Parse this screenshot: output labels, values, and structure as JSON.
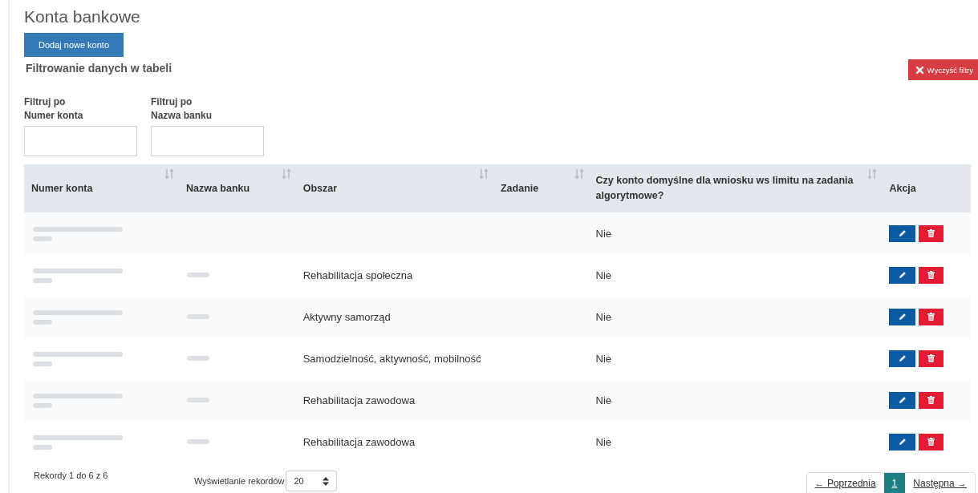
{
  "page_title": "Konta bankowe",
  "add_button": "Dodaj nowe konto",
  "filter_heading": "Filtrowanie danych w tabeli",
  "clear_button": "Wyczyść filtry",
  "filters": [
    {
      "label_line1": "Filtruj po",
      "label_line2": "Numer konta"
    },
    {
      "label_line1": "Filtruj po",
      "label_line2": "Nazwa banku"
    }
  ],
  "table": {
    "columns": [
      {
        "label": "Numer konta",
        "sortable": true
      },
      {
        "label": "Nazwa banku",
        "sortable": true
      },
      {
        "label": "Obszar",
        "sortable": true
      },
      {
        "label": "Zadanie",
        "sortable": true
      },
      {
        "label": "Czy konto domyślne dla wniosku ws limitu na zadania algorytmowe?",
        "sortable": true
      },
      {
        "label": "Akcja",
        "sortable": false
      }
    ],
    "rows": [
      {
        "account_redacted": true,
        "bank_redacted": false,
        "area": "",
        "default": "Nie"
      },
      {
        "account_redacted": true,
        "bank_redacted": true,
        "area": "Rehabilitacja społeczna",
        "default": "Nie"
      },
      {
        "account_redacted": true,
        "bank_redacted": true,
        "area": "Aktywny samorząd",
        "default": "Nie"
      },
      {
        "account_redacted": true,
        "bank_redacted": true,
        "area": "Samodzielność, aktywność, mobilność",
        "default": "Nie"
      },
      {
        "account_redacted": true,
        "bank_redacted": true,
        "area": "Rehabilitacja zawodowa",
        "default": "Nie"
      },
      {
        "account_redacted": true,
        "bank_redacted": true,
        "area": "Rehabilitacja zawodowa",
        "default": "Nie"
      }
    ]
  },
  "footer": {
    "records_info": "Rekordy 1 do 6 z 6",
    "page_size_label": "Wyświetlanie rekordów",
    "page_size": "20"
  },
  "pagination": {
    "previous": "← Poprzednia",
    "pages": [
      {
        "label": "1",
        "selected": true
      }
    ],
    "next": "Następna →"
  }
}
